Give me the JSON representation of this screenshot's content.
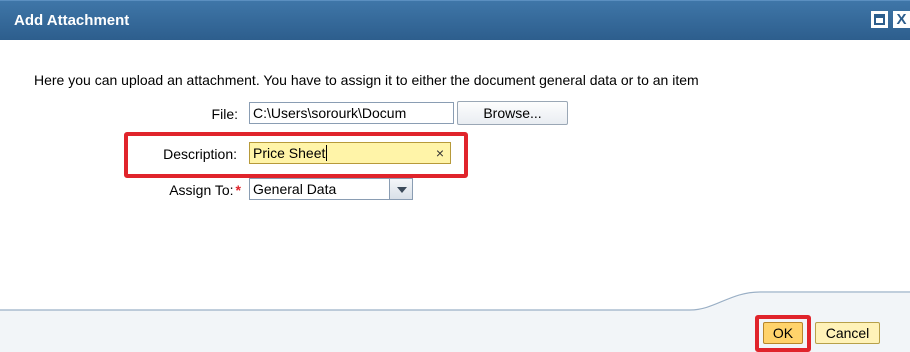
{
  "window": {
    "title": "Add Attachment",
    "maximize_icon": "window-maximize-icon",
    "close_icon": "close-icon",
    "close_glyph": "X"
  },
  "intro_text": "Here you can upload an attachment. You have to assign it to either the document general data or to an item",
  "file": {
    "label": "File:",
    "value": "C:\\Users\\sorourk\\Docum",
    "browse_label": "Browse..."
  },
  "description": {
    "label": "Description:",
    "value": "Price Sheet",
    "clear_glyph": "×"
  },
  "assign_to": {
    "label": "Assign To:",
    "required_mark": "*",
    "value": "General Data"
  },
  "buttons": {
    "ok": "OK",
    "cancel": "Cancel"
  },
  "colors": {
    "titlebar": "#2d5e8d",
    "highlight": "#e0242b",
    "required": "#e0242b"
  }
}
